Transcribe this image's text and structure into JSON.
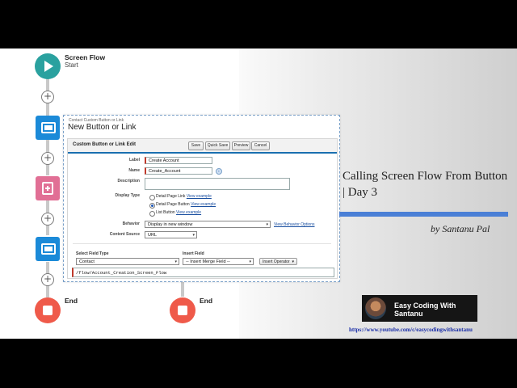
{
  "flow": {
    "start_title": "Screen Flow",
    "start_subtitle": "Start",
    "end_label_left": "End",
    "end_label_right": "End",
    "node_icons": [
      "play-icon",
      "screen-icon",
      "assignment-icon",
      "screen-icon",
      "stop-icon"
    ]
  },
  "dialog": {
    "breadcrumb": "Contact Custom Button or Link",
    "title": "New Button or Link",
    "panel_title": "Custom Button or Link Edit",
    "buttons": [
      "Save",
      "Quick Save",
      "Preview",
      "Cancel"
    ],
    "label_label": "Label",
    "label_value": "Create Account",
    "name_label": "Name",
    "name_value": "Create_Account",
    "description_label": "Description",
    "display_type_label": "Display Type",
    "display_types": [
      {
        "text": "Detail Page Link",
        "link": "View example",
        "selected": false
      },
      {
        "text": "Detail Page Button",
        "link": "View example",
        "selected": true
      },
      {
        "text": "List Button",
        "link": "View example",
        "selected": false
      }
    ],
    "behavior_label": "Behavior",
    "behavior_value": "Display in new window",
    "behavior_link": "View Behavior Options",
    "content_source_label": "Content Source",
    "content_source_value": "URL",
    "select_field_type_label": "Select Field Type",
    "select_field_type_value": "Contact",
    "insert_field_label": "Insert Field",
    "insert_field_value": "-- Insert Merge Field --",
    "insert_operator_label": "Insert Operator",
    "url_value": "/flow/Account_Creation_Screen_Flow"
  },
  "video": {
    "title": "Calling Screen Flow From Button | Day 3",
    "author": "by Santanu Pal",
    "channel_name": "Easy Coding With Santanu",
    "channel_url": "https://www.youtube.com/c/easycodingwithsantanu"
  },
  "colors": {
    "start_node": "#2aa19f",
    "screen_node": "#1b8ad8",
    "assignment_node": "#e16f95",
    "end_node": "#ef5a4a",
    "accent_bar": "#4a7fd6"
  }
}
